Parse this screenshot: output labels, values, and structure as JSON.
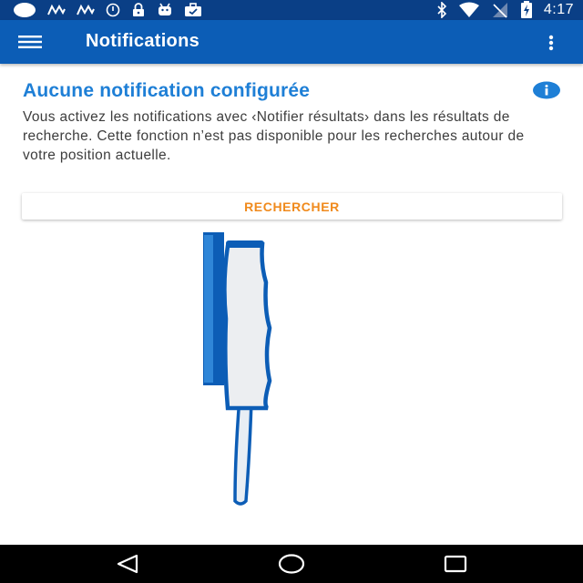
{
  "status_bar": {
    "time": "4:17",
    "left_icons": [
      "notification-dot-icon",
      "signal-wave-icon",
      "signal-wave-icon",
      "clock-circle-icon",
      "lock-icon",
      "android-icon",
      "briefcase-icon"
    ],
    "right_icons": [
      "bluetooth-icon",
      "wifi-icon",
      "no-signal-icon",
      "battery-charging-icon"
    ]
  },
  "app_bar": {
    "title": "Notifications",
    "menu_icon": "hamburger-menu-icon",
    "overflow_icon": "more-vert-icon"
  },
  "content": {
    "title": "Aucune notification configurée",
    "info_icon": "info-icon",
    "description": "Vous activez les notifications avec ‹Notifier résultats› dans les résultats de recherche. Cette fonction n’est pas disponible pour les recherches autour de votre position actuelle.",
    "search_button": "RECHERCHER"
  },
  "colors": {
    "status_bar": "#0a3f86",
    "app_bar": "#0c5db6",
    "title_blue": "#1e7fd6",
    "accent_orange": "#f08a1c",
    "text": "#3d3d3d"
  },
  "nav_bar": {
    "icons": [
      "back-triangle-icon",
      "home-circle-icon",
      "recents-square-icon"
    ]
  }
}
